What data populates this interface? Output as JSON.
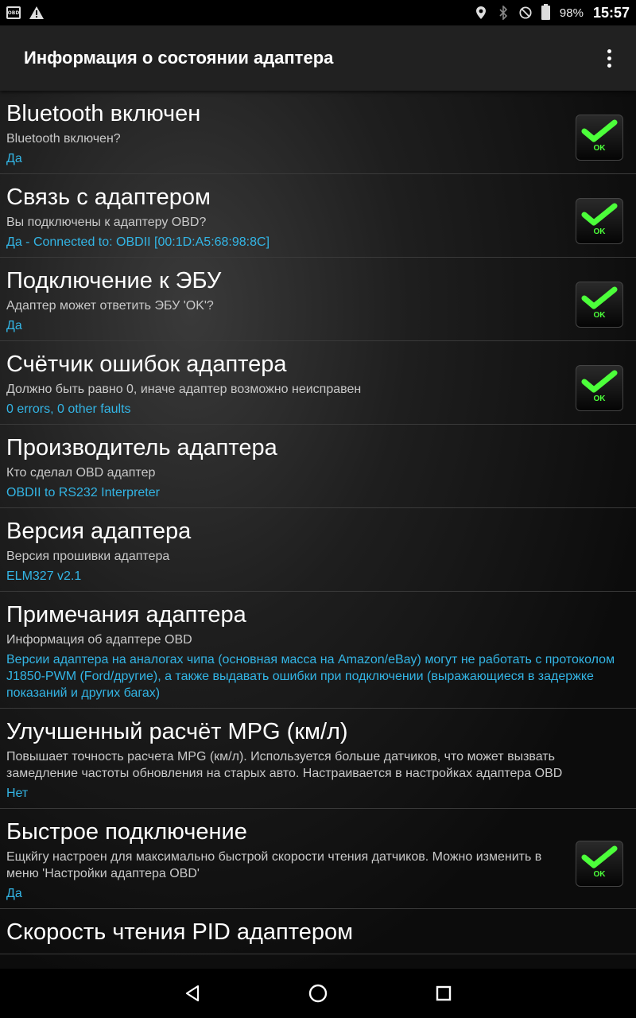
{
  "status_bar": {
    "obd_icon_text": "OBD",
    "battery": "98%",
    "time": "15:57",
    "icons": [
      "obd-icon",
      "warning-icon",
      "location-icon",
      "bluetooth-icon",
      "do-not-disturb-icon",
      "battery-icon"
    ]
  },
  "app_bar": {
    "title": "Информация о состоянии адаптера",
    "menu_icon": "overflow-menu-icon"
  },
  "items": [
    {
      "title": "Bluetooth включен",
      "summary": "Bluetooth включен?",
      "value": "Да",
      "check": true,
      "check_label": "OK"
    },
    {
      "title": "Связь с адаптером",
      "summary": "Вы подключены к адаптеру OBD?",
      "value": "Да - Connected to: OBDII [00:1D:A5:68:98:8C]",
      "check": true,
      "check_label": "OK"
    },
    {
      "title": "Подключение к ЭБУ",
      "summary": "Адаптер может ответить ЭБУ 'OK'?",
      "value": "Да",
      "check": true,
      "check_label": "OK"
    },
    {
      "title": "Счётчик ошибок адаптера",
      "summary": "Должно быть равно 0, иначе адаптер возможно неисправен",
      "value": "0 errors, 0 other faults",
      "check": true,
      "check_label": "OK"
    },
    {
      "title": "Производитель адаптера",
      "summary": "Кто сделал OBD адаптер",
      "value": "OBDII to RS232 Interpreter",
      "check": false
    },
    {
      "title": "Версия адаптера",
      "summary": "Версия прошивки адаптера",
      "value": "ELM327 v2.1",
      "check": false
    },
    {
      "title": "Примечания адаптера",
      "summary": "Информация об адаптере OBD",
      "value": "Версии адаптера на аналогах чипа (основная масса на Amazon/eBay) могут не работать с протоколом J1850-PWM (Ford/другие), а также выдавать ошибки при подключении (выражающиеся в задержке показаний и других багах)",
      "check": false
    },
    {
      "title": "Улучшенный расчёт MPG (км/л)",
      "summary": "Повышает точность расчета MPG (км/л). Используется больше датчиков, что может вызвать замедление частоты обновления на старых авто. Настраивается в настройках адаптера OBD",
      "value": "Нет",
      "check": false
    },
    {
      "title": "Быстрое подключение",
      "summary": "Ещкйгу настроен для максимально быстрой скорости чтения датчиков. Можно изменить в меню 'Настройки адаптера OBD'",
      "value": "Да",
      "check": true,
      "check_label": "OK"
    },
    {
      "title": "Скорость чтения PID адаптером",
      "summary": "",
      "value": "",
      "check": false
    }
  ],
  "nav_bar": {
    "buttons": [
      "back-icon",
      "home-icon",
      "recents-icon"
    ]
  },
  "colors": {
    "accent_value": "#33b5e5",
    "ok_green": "#4cff3a",
    "app_bar_bg": "#212121"
  }
}
